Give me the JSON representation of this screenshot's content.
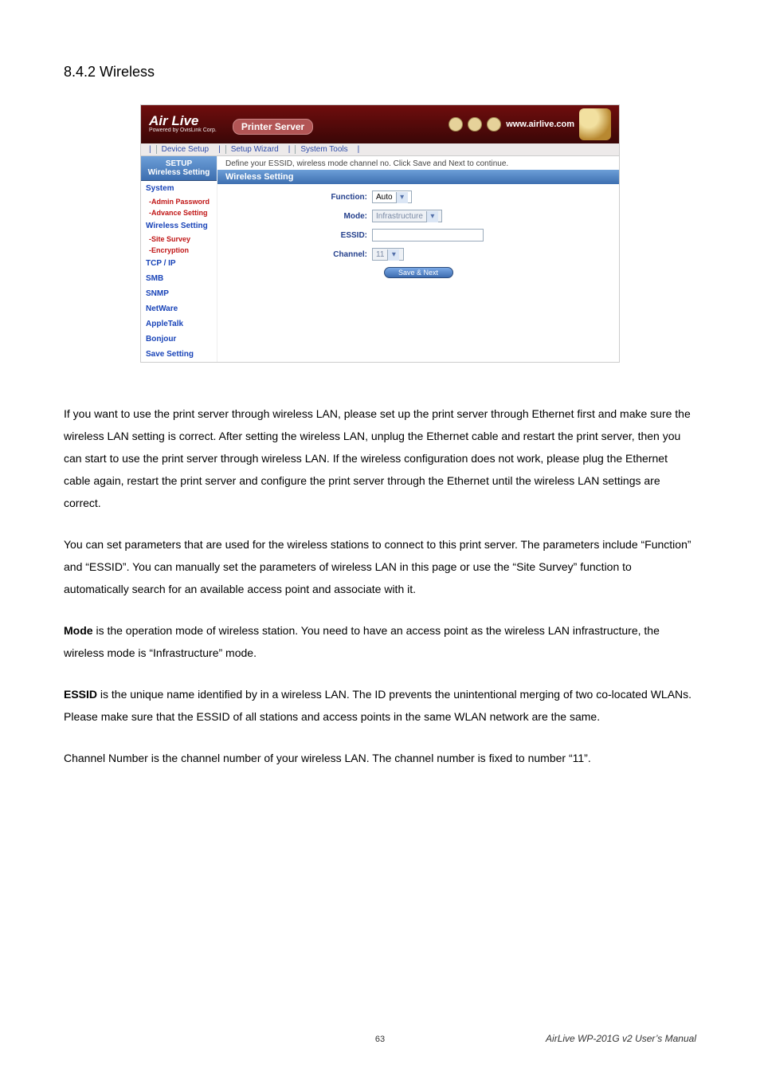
{
  "section_title": "8.4.2 Wireless",
  "screenshot": {
    "logo_main": "Air Live",
    "logo_sub": "Powered by OvisLink Corp.",
    "header_title": "Printer Server",
    "url": "www.airlive.com",
    "tabs": [
      "Device Setup",
      "Setup Wizard",
      "System Tools"
    ],
    "side_head1": "SETUP",
    "side_head2": "Wireless Setting",
    "sidebar": [
      {
        "label": "System",
        "cls": "c-blue",
        "type": "item"
      },
      {
        "label": "-Admin Password",
        "cls": "c-red",
        "type": "sub"
      },
      {
        "label": "-Advance Setting",
        "cls": "c-red",
        "type": "sub"
      },
      {
        "label": "Wireless Setting",
        "cls": "c-blue",
        "type": "item"
      },
      {
        "label": "-Site Survey",
        "cls": "c-red",
        "type": "sub"
      },
      {
        "label": "-Encryption",
        "cls": "c-red",
        "type": "sub"
      },
      {
        "label": "TCP / IP",
        "cls": "c-blue",
        "type": "item"
      },
      {
        "label": "SMB",
        "cls": "c-blue",
        "type": "item"
      },
      {
        "label": "SNMP",
        "cls": "c-blue",
        "type": "item"
      },
      {
        "label": "NetWare",
        "cls": "c-blue",
        "type": "item"
      },
      {
        "label": "AppleTalk",
        "cls": "c-blue",
        "type": "item"
      },
      {
        "label": "Bonjour",
        "cls": "c-blue",
        "type": "item"
      },
      {
        "label": "Save Setting",
        "cls": "c-blue",
        "type": "item"
      }
    ],
    "main_desc": "Define your ESSID, wireless mode channel no. Click Save and Next to continue.",
    "main_title": "Wireless Setting",
    "form": {
      "function_label": "Function:",
      "function_value": "Auto",
      "mode_label": "Mode:",
      "mode_value": "Infrastructure",
      "essid_label": "ESSID:",
      "essid_value": "",
      "channel_label": "Channel:",
      "channel_value": "11",
      "save_btn": "Save & Next"
    }
  },
  "paragraphs": {
    "p1": "If you want to use the print server through wireless LAN, please set up the print server through Ethernet first and make sure the wireless LAN setting is correct. After setting the wireless LAN, unplug the Ethernet cable and restart the print server, then you can start to use the print server through wireless LAN. If the wireless configuration does not work, please plug the Ethernet cable again, restart the print server and configure the print server through the Ethernet until the wireless LAN settings are correct.",
    "p2": "You can set parameters that are used for the wireless stations to connect to this print server. The parameters include “Function” and “ESSID”. You can manually set the parameters of wireless LAN in this page or use the “Site Survey” function to automatically search for an available access point and associate with it.",
    "p3a": "Mode",
    "p3b": " is the operation mode of wireless station. You need to have an access point as the wireless LAN infrastructure, the wireless mode is “Infrastructure” mode.",
    "p4a": "ESSID",
    "p4b": " is the unique name identified by in a wireless LAN. The ID prevents the unintentional merging of two co-located WLANs. Please make sure that the ESSID of all stations and access points in the same WLAN network are the same.",
    "p5": "Channel Number is the channel number of your wireless LAN. The channel number is fixed to number “11”."
  },
  "footer": "AirLive WP-201G v2 User’s Manual",
  "page_num": "63"
}
